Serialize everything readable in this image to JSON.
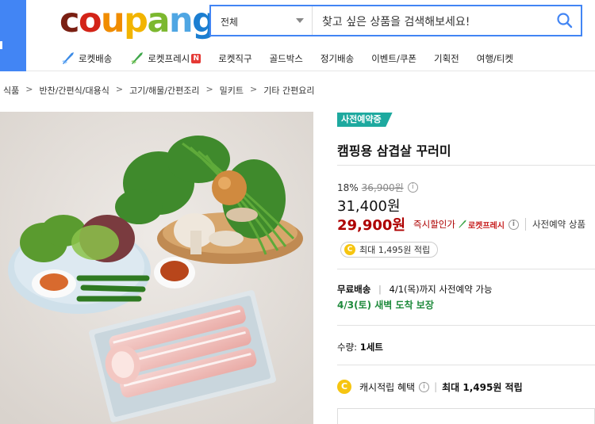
{
  "header": {
    "logo": "coupang",
    "search": {
      "scope": "전체",
      "placeholder": "찾고 싶은 상품을 검색해보세요!"
    },
    "nav": [
      {
        "label": "로켓배송",
        "icon": "rocket-blue-icon"
      },
      {
        "label": "로켓프레시",
        "icon": "rocket-green-icon",
        "badge": "N"
      },
      {
        "label": "로켓직구"
      },
      {
        "label": "골드박스"
      },
      {
        "label": "정기배송"
      },
      {
        "label": "이벤트/쿠폰"
      },
      {
        "label": "기획전"
      },
      {
        "label": "여행/티켓"
      }
    ]
  },
  "breadcrumb": [
    "식품",
    "반찬/간편식/대용식",
    "고기/해물/간편조리",
    "밀키트",
    "기타 간편요리"
  ],
  "product": {
    "badge": "사전예약중",
    "title": "캠핑용 삼겹살 꾸러미",
    "discount_rate": "18%",
    "original_price": "36,900원",
    "price": "31,400원",
    "instant_price": "29,900원",
    "instant_label": "즉시할인가",
    "rocket_fresh": "로켓프레시",
    "presale_label": "사전예약 상품",
    "reward": "최대 1,495원 적립",
    "shipping": {
      "free_label": "무료배송",
      "preorder_note": "4/1(목)까지 사전예약 가능",
      "arrival": "4/3(토) 새벽 도착 보장"
    },
    "quantity": {
      "label": "수량:",
      "value": "1세트"
    },
    "cash_benefit": {
      "label": "캐시적립 혜택",
      "value": "최대 1,495원 적립"
    }
  },
  "colors": {
    "brand_blue": "#4285f4",
    "price_red": "#ae0000",
    "fresh_green": "#1e8a3b",
    "badge_teal": "#1ea99f"
  }
}
